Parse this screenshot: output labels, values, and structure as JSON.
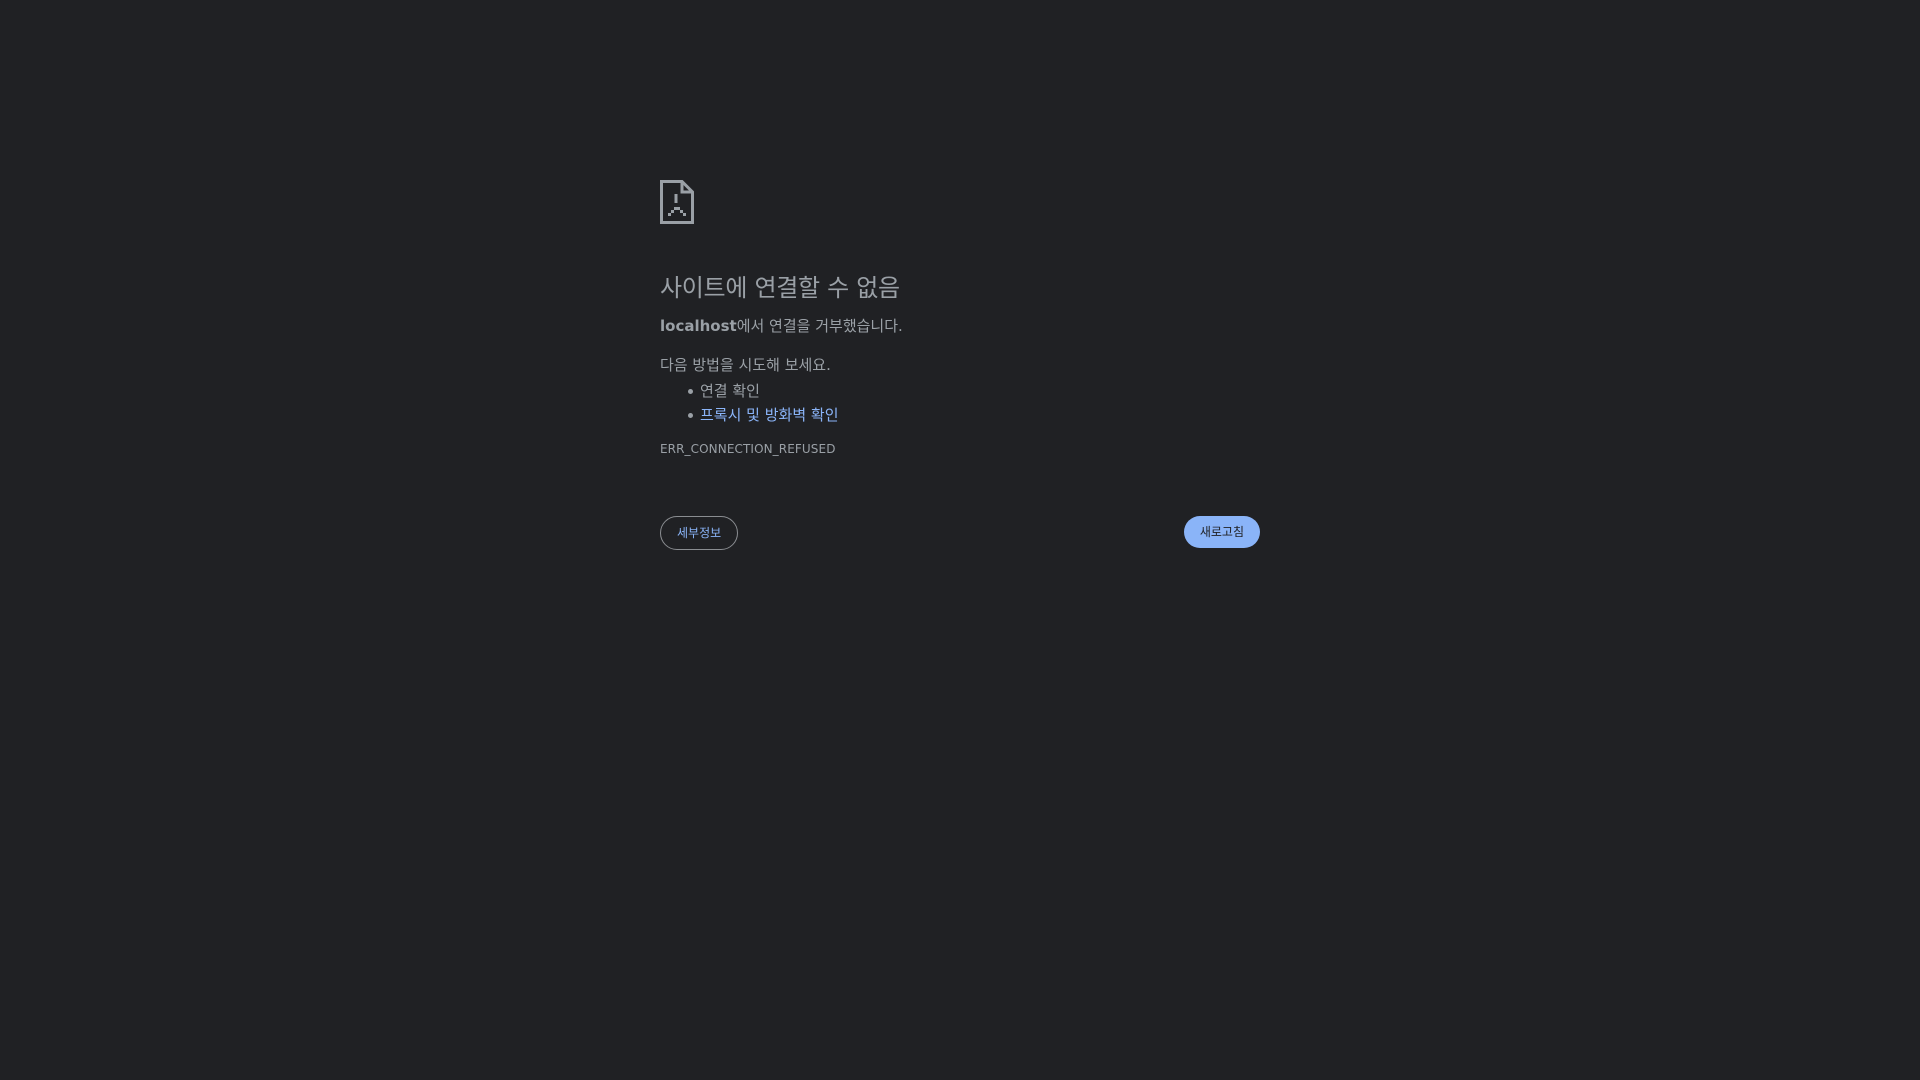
{
  "error": {
    "icon": "sad-document-icon",
    "title": "사이트에 연결할 수 없음",
    "host": "localhost",
    "summary_suffix": "에서 연결을 거부했습니다.",
    "suggestions_intro": "다음 방법을 시도해 보세요.",
    "suggestions": [
      {
        "label": "연결 확인",
        "is_link": false
      },
      {
        "label": "프록시 및 방화벽 확인",
        "is_link": true
      }
    ],
    "code": "ERR_CONNECTION_REFUSED"
  },
  "buttons": {
    "details_label": "세부정보",
    "reload_label": "새로고침"
  },
  "colors": {
    "background": "#202124",
    "text": "#9aa0a6",
    "accent": "#8ab4f8"
  }
}
